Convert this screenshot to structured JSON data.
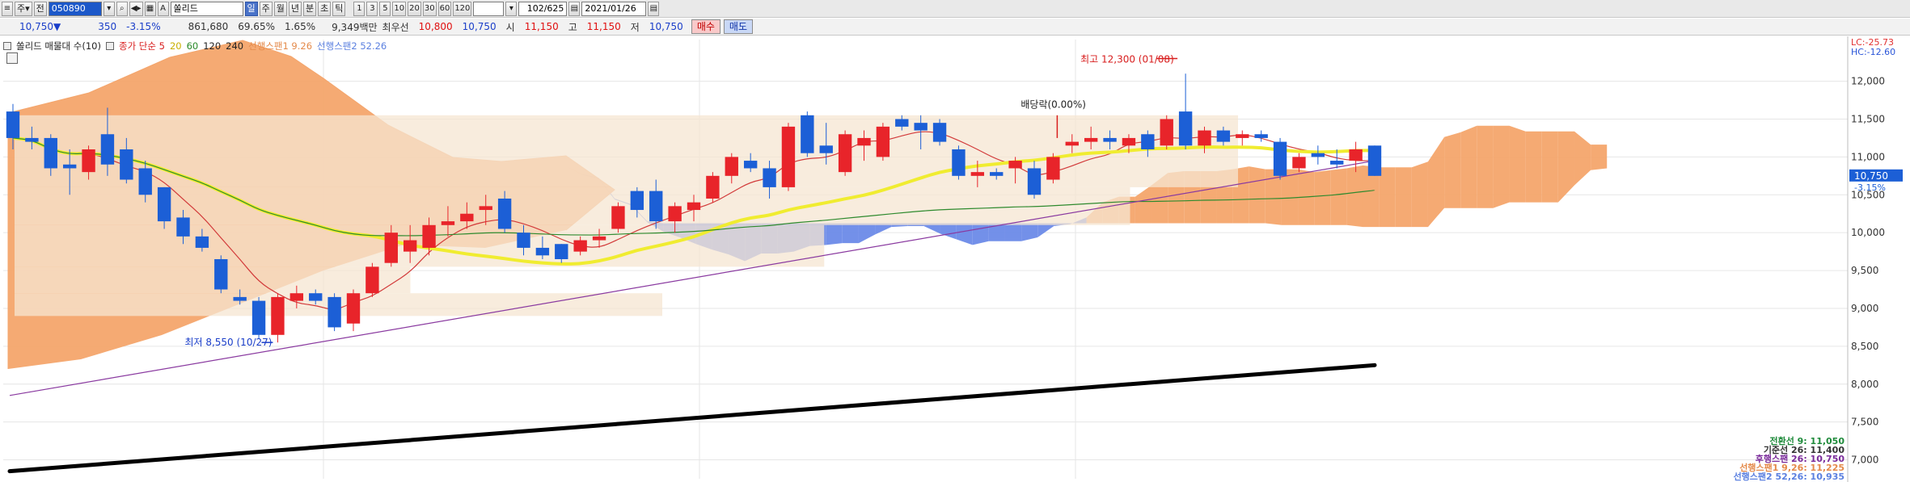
{
  "toolbar": {
    "icon1": "≡",
    "mode_label": "주",
    "prev_label": "전",
    "code_value": "050890",
    "name_prefix": "A",
    "name_value": "쏠리드",
    "period_day": "일",
    "period_week": "주",
    "period_month": "월",
    "period_year": "년",
    "period_min": "분",
    "period_tick": "초",
    "period_ticklabel": "틱",
    "interval_buttons": [
      "1",
      "3",
      "5",
      "10",
      "20",
      "30",
      "60",
      "120"
    ],
    "empty_select": "",
    "count_value": "102/625",
    "date_value": "2021/01/26"
  },
  "quote": {
    "price": "10,750",
    "down_arrow": "▼",
    "change": "350",
    "change_pct": "-3.15%",
    "volume": "861,680",
    "vol_ratio": "69.65%",
    "turnover": "1.65%",
    "amount": "9,349백만",
    "best_label": "최우선",
    "bid": "10,800",
    "ask": "10,750",
    "open_label": "시",
    "open": "11,150",
    "high_label": "고",
    "high": "11,150",
    "low_label": "저",
    "low": "10,750",
    "buy_label": "매수",
    "sell_label": "매도"
  },
  "legend": {
    "name": "쏠리드 매물대 수(10)",
    "ma_label": "종가 단순 5",
    "ma20": "20",
    "ma60": "60",
    "ma120": "120",
    "ma240": "240",
    "span1": "선행스팬1 9.26",
    "span2": "선행스팬2 52.26"
  },
  "axis_labels": {
    "lc": "LC:-25.73",
    "hc": "HC:-12.60",
    "current": "10,750",
    "current_pct": "-3.15%"
  },
  "annotations": {
    "high": "최고 12,300 (01/08)",
    "low": "최저 8,550 (10/27)",
    "dividend": "배당락(0.00%)"
  },
  "ichimoku_readout": [
    {
      "label": "전환선 9: 11,050",
      "color": "#1e8a3a"
    },
    {
      "label": "기준선 26: 11,400",
      "color": "#333333"
    },
    {
      "label": "후행스팬 26: 10,750",
      "color": "#7a2a9a"
    },
    {
      "label": "선행스팬1 9,26: 11,225",
      "color": "#e48a4a"
    },
    {
      "label": "선행스팬2 52,26: 10,935",
      "color": "#5b80e0"
    }
  ],
  "colors": {
    "up": "#e8242a",
    "down": "#1c5fd6",
    "cloud_org": "#f4a56c",
    "cloud_blu": "#6b8ae8",
    "vol_profile": "#f6e6d2",
    "ma5": "#d23a3a",
    "ma20": "#f0ec30",
    "ma60": "#2e8a2e",
    "ma120": "#8a3aa0",
    "ma240": "#000000"
  },
  "chart_data": {
    "type": "candlestick",
    "ylim": [
      6750,
      12550
    ],
    "y_ticks": [
      7000,
      7500,
      8000,
      8500,
      9000,
      9500,
      10000,
      10500,
      11000,
      11500,
      12000
    ],
    "y_tick_labels": [
      "7,000",
      "7,500",
      "8,000",
      "8,500",
      "9,000",
      "9,500",
      "10,000",
      "10,500",
      "11,000",
      "11,500",
      "12,000"
    ],
    "candles": [
      {
        "o": 11600,
        "h": 11700,
        "l": 11100,
        "c": 11250
      },
      {
        "o": 11250,
        "h": 11400,
        "l": 11100,
        "c": 11200
      },
      {
        "o": 11250,
        "h": 11300,
        "l": 10750,
        "c": 10850
      },
      {
        "o": 10900,
        "h": 11100,
        "l": 10500,
        "c": 10850
      },
      {
        "o": 10800,
        "h": 11150,
        "l": 10700,
        "c": 11100
      },
      {
        "o": 11300,
        "h": 11650,
        "l": 10750,
        "c": 10900
      },
      {
        "o": 11100,
        "h": 11250,
        "l": 10650,
        "c": 10700
      },
      {
        "o": 10850,
        "h": 10950,
        "l": 10400,
        "c": 10500
      },
      {
        "o": 10600,
        "h": 10600,
        "l": 10050,
        "c": 10150
      },
      {
        "o": 10200,
        "h": 10300,
        "l": 9850,
        "c": 9950
      },
      {
        "o": 9950,
        "h": 10050,
        "l": 9750,
        "c": 9800
      },
      {
        "o": 9650,
        "h": 9700,
        "l": 9200,
        "c": 9250
      },
      {
        "o": 9150,
        "h": 9250,
        "l": 9050,
        "c": 9100
      },
      {
        "o": 9100,
        "h": 9150,
        "l": 8600,
        "c": 8650
      },
      {
        "o": 8650,
        "h": 9200,
        "l": 8550,
        "c": 9150
      },
      {
        "o": 9100,
        "h": 9300,
        "l": 9000,
        "c": 9200
      },
      {
        "o": 9200,
        "h": 9250,
        "l": 9050,
        "c": 9100
      },
      {
        "o": 9150,
        "h": 9200,
        "l": 8700,
        "c": 8750
      },
      {
        "o": 8800,
        "h": 9250,
        "l": 8700,
        "c": 9200
      },
      {
        "o": 9200,
        "h": 9600,
        "l": 9150,
        "c": 9550
      },
      {
        "o": 9600,
        "h": 10100,
        "l": 9550,
        "c": 10000
      },
      {
        "o": 9750,
        "h": 10100,
        "l": 9600,
        "c": 9900
      },
      {
        "o": 9800,
        "h": 10200,
        "l": 9700,
        "c": 10100
      },
      {
        "o": 10100,
        "h": 10350,
        "l": 9950,
        "c": 10150
      },
      {
        "o": 10150,
        "h": 10400,
        "l": 10050,
        "c": 10250
      },
      {
        "o": 10300,
        "h": 10500,
        "l": 10100,
        "c": 10350
      },
      {
        "o": 10450,
        "h": 10550,
        "l": 10000,
        "c": 10050
      },
      {
        "o": 10000,
        "h": 10100,
        "l": 9700,
        "c": 9800
      },
      {
        "o": 9800,
        "h": 9950,
        "l": 9650,
        "c": 9700
      },
      {
        "o": 9850,
        "h": 9850,
        "l": 9600,
        "c": 9650
      },
      {
        "o": 9750,
        "h": 9950,
        "l": 9700,
        "c": 9900
      },
      {
        "o": 9900,
        "h": 10050,
        "l": 9800,
        "c": 9950
      },
      {
        "o": 10050,
        "h": 10400,
        "l": 10000,
        "c": 10350
      },
      {
        "o": 10550,
        "h": 10600,
        "l": 10200,
        "c": 10300
      },
      {
        "o": 10550,
        "h": 10700,
        "l": 10050,
        "c": 10150
      },
      {
        "o": 10150,
        "h": 10400,
        "l": 10000,
        "c": 10350
      },
      {
        "o": 10300,
        "h": 10500,
        "l": 10150,
        "c": 10400
      },
      {
        "o": 10450,
        "h": 10800,
        "l": 10400,
        "c": 10750
      },
      {
        "o": 10750,
        "h": 11050,
        "l": 10650,
        "c": 11000
      },
      {
        "o": 10950,
        "h": 11050,
        "l": 10800,
        "c": 10850
      },
      {
        "o": 10850,
        "h": 10950,
        "l": 10450,
        "c": 10600
      },
      {
        "o": 10600,
        "h": 11450,
        "l": 10550,
        "c": 11400
      },
      {
        "o": 11550,
        "h": 11600,
        "l": 11000,
        "c": 11050
      },
      {
        "o": 11150,
        "h": 11450,
        "l": 10900,
        "c": 11050
      },
      {
        "o": 10800,
        "h": 11350,
        "l": 10750,
        "c": 11300
      },
      {
        "o": 11150,
        "h": 11350,
        "l": 10950,
        "c": 11250
      },
      {
        "o": 11000,
        "h": 11450,
        "l": 10950,
        "c": 11400
      },
      {
        "o": 11500,
        "h": 11550,
        "l": 11350,
        "c": 11400
      },
      {
        "o": 11450,
        "h": 11550,
        "l": 11100,
        "c": 11350
      },
      {
        "o": 11450,
        "h": 11500,
        "l": 11150,
        "c": 11200
      },
      {
        "o": 11100,
        "h": 11150,
        "l": 10700,
        "c": 10750
      },
      {
        "o": 10750,
        "h": 10950,
        "l": 10600,
        "c": 10800
      },
      {
        "o": 10800,
        "h": 10850,
        "l": 10700,
        "c": 10750
      },
      {
        "o": 10850,
        "h": 11000,
        "l": 10650,
        "c": 10950
      },
      {
        "o": 10850,
        "h": 10950,
        "l": 10450,
        "c": 10500
      },
      {
        "o": 10700,
        "h": 11050,
        "l": 10650,
        "c": 11000
      },
      {
        "o": 11150,
        "h": 11300,
        "l": 11050,
        "c": 11200
      },
      {
        "o": 11200,
        "h": 11400,
        "l": 11100,
        "c": 11250
      },
      {
        "o": 11250,
        "h": 11350,
        "l": 11100,
        "c": 11200
      },
      {
        "o": 11150,
        "h": 11300,
        "l": 11050,
        "c": 11250
      },
      {
        "o": 11300,
        "h": 11350,
        "l": 11000,
        "c": 11100
      },
      {
        "o": 11150,
        "h": 11550,
        "l": 11100,
        "c": 11500
      },
      {
        "o": 11600,
        "h": 12100,
        "l": 11100,
        "c": 11150
      },
      {
        "o": 11150,
        "h": 11400,
        "l": 11050,
        "c": 11350
      },
      {
        "o": 11350,
        "h": 11400,
        "l": 11150,
        "c": 11200
      },
      {
        "o": 11250,
        "h": 11350,
        "l": 11150,
        "c": 11300
      },
      {
        "o": 11300,
        "h": 11350,
        "l": 11200,
        "c": 11250
      },
      {
        "o": 11200,
        "h": 11250,
        "l": 10700,
        "c": 10750
      },
      {
        "o": 10850,
        "h": 11050,
        "l": 10800,
        "c": 11000
      },
      {
        "o": 11050,
        "h": 11150,
        "l": 10900,
        "c": 11000
      },
      {
        "o": 10950,
        "h": 11100,
        "l": 10850,
        "c": 10900
      },
      {
        "o": 10950,
        "h": 11200,
        "l": 10800,
        "c": 11100
      },
      {
        "o": 11150,
        "h": 11150,
        "l": 10750,
        "c": 10750
      }
    ]
  }
}
